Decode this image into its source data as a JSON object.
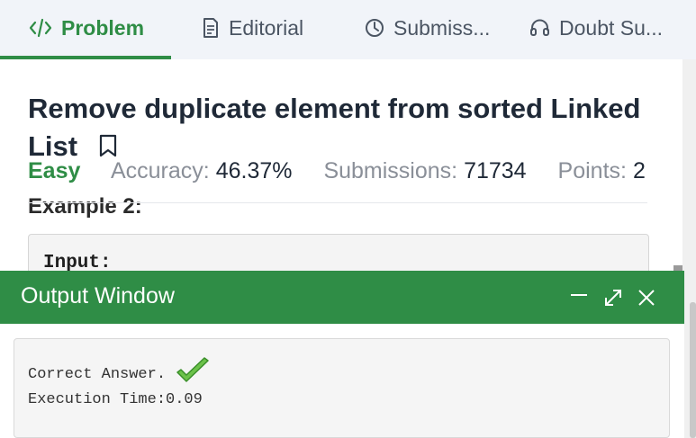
{
  "tabs": [
    {
      "label": "Problem",
      "icon": "code-icon",
      "active": true
    },
    {
      "label": "Editorial",
      "icon": "document-icon"
    },
    {
      "label": "Submiss...",
      "icon": "clock-icon"
    },
    {
      "label": "Doubt Su...",
      "icon": "headset-icon"
    }
  ],
  "problem": {
    "title_line1": "Remove duplicate element from sorted Linked",
    "title_line2": "List",
    "difficulty": "Easy",
    "accuracy_label": "Accuracy:",
    "accuracy_value": "46.37%",
    "submissions_label": "Submissions:",
    "submissions_value": "71734",
    "points_label": "Points:",
    "points_value": "2",
    "example_heading": "Example 2:",
    "input_label": "Input:"
  },
  "output_window": {
    "title": "Output Window",
    "result_text": "Correct Answer.",
    "execution_time": "Execution Time:0.09"
  },
  "colors": {
    "brand_green": "#2f8d46",
    "tab_bar_bg": "#f1f4f9"
  }
}
